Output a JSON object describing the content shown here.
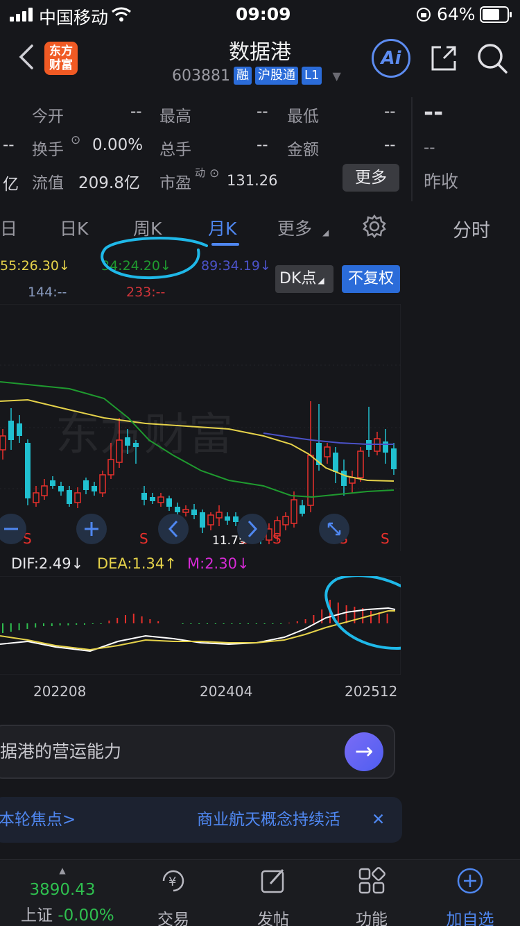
{
  "status_bar": {
    "carrier": "中国移动",
    "time": "09:09",
    "battery": "64%"
  },
  "header": {
    "title": "数据港",
    "code": "603881",
    "tags": [
      "融",
      "沪股通",
      "L1"
    ],
    "logo_text": "东方财富",
    "ai_label": "Ai"
  },
  "stats": {
    "open_label": "今开",
    "open_value": "--",
    "high_label": "最高",
    "high_value": "--",
    "low_label": "最低",
    "low_value": "--",
    "turnover_label": "换手",
    "turnover_value": "0.00%",
    "volume_label": "总手",
    "volume_value": "--",
    "amount_label": "金额",
    "amount_value": "--",
    "float_label": "流值",
    "float_value": "209.8亿",
    "pe_label": "市盈",
    "pe_sup": "动",
    "pe_value": "131.26",
    "more_label": "更多",
    "left_cut_1": "--",
    "left_cut_2": "亿"
  },
  "right_panel": {
    "price": "--",
    "change": "--",
    "prev_close_label": "昨收",
    "intraday_label": "分时"
  },
  "tabs": [
    {
      "label": "日"
    },
    {
      "label": "日K"
    },
    {
      "label": "周K"
    },
    {
      "label": "月K",
      "active": true
    },
    {
      "label": "更多"
    }
  ],
  "ma": {
    "ma55": "55:26.30↓",
    "ma34": "34:24.20↓",
    "ma89": "89:34.19↓",
    "ma144": "144:--",
    "ma233": "233:--"
  },
  "buttons": {
    "dk": "DK点",
    "fq": "不复权"
  },
  "chart": {
    "watermark": "东方财富",
    "low_marker": "11.75",
    "signal": "S",
    "macd": {
      "dif": "DIF:2.49↓",
      "dea": "DEA:1.34↑",
      "m": "M:2.30↓"
    },
    "x_labels": [
      "202208",
      "202404",
      "202512"
    ]
  },
  "ask": {
    "text": "据港的营运能力"
  },
  "focus": {
    "left": "本轮焦点>",
    "right": "商业航天概念持续活"
  },
  "tabbar": {
    "index_value": "3890.43",
    "index_name": "上证",
    "index_change": "-0.00%",
    "trade": "交易",
    "post": "发帖",
    "func": "功能",
    "add": "加自选"
  },
  "colors": {
    "up": "#e8302c",
    "down": "#20c0d0",
    "accent": "#4f87f0",
    "ma_yellow": "#e5d24a",
    "ma_green": "#1f9a2f",
    "ma_blue": "#4b52c8"
  }
}
